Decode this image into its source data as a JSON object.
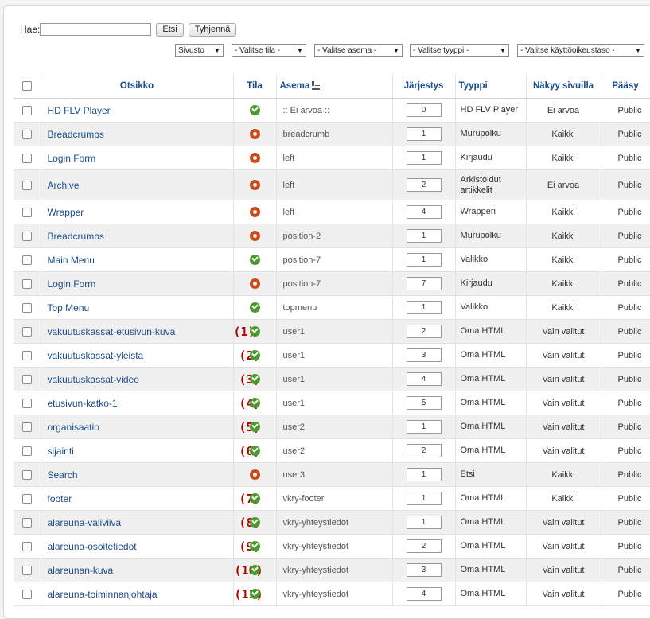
{
  "search": {
    "label": "Hae:",
    "value": "",
    "placeholder": "",
    "search_button": "Etsi",
    "clear_button": "Tyhjennä"
  },
  "filters": {
    "site": "Sivusto",
    "state": "- Valitse tila -",
    "position": "- Valitse asema -",
    "type": "- Valitse tyyppi -",
    "access": "- Valitse käyttöoikeustaso -"
  },
  "headers": {
    "title": "Otsikko",
    "status": "Tila",
    "position": "Asema",
    "order": "Järjestys",
    "type": "Tyyppi",
    "pages": "Näkyy sivuilla",
    "access": "Pääsy"
  },
  "colors": {
    "published": "#4a9a2d",
    "unpublished": "#cc4a17",
    "link": "#1a4c8b",
    "annotation": "#b00000"
  },
  "rows": [
    {
      "title": "HD FLV Player",
      "status": "published",
      "position": ":: Ei arvoa ::",
      "order": "0",
      "type": "HD FLV Player",
      "pages": "Ei arvoa",
      "access": "Public",
      "annotation": ""
    },
    {
      "title": "Breadcrumbs",
      "status": "unpublished",
      "position": "breadcrumb",
      "order": "1",
      "type": "Murupolku",
      "pages": "Kaikki",
      "access": "Public",
      "annotation": ""
    },
    {
      "title": "Login Form",
      "status": "unpublished",
      "position": "left",
      "order": "1",
      "type": "Kirjaudu",
      "pages": "Kaikki",
      "access": "Public",
      "annotation": ""
    },
    {
      "title": "Archive",
      "status": "unpublished",
      "position": "left",
      "order": "2",
      "type": "Arkistoidut artikkelit",
      "pages": "Ei arvoa",
      "access": "Public",
      "annotation": ""
    },
    {
      "title": "Wrapper",
      "status": "unpublished",
      "position": "left",
      "order": "4",
      "type": "Wrapperi",
      "pages": "Kaikki",
      "access": "Public",
      "annotation": ""
    },
    {
      "title": "Breadcrumbs",
      "status": "unpublished",
      "position": "position-2",
      "order": "1",
      "type": "Murupolku",
      "pages": "Kaikki",
      "access": "Public",
      "annotation": ""
    },
    {
      "title": "Main Menu",
      "status": "published",
      "position": "position-7",
      "order": "1",
      "type": "Valikko",
      "pages": "Kaikki",
      "access": "Public",
      "annotation": ""
    },
    {
      "title": "Login Form",
      "status": "unpublished",
      "position": "position-7",
      "order": "7",
      "type": "Kirjaudu",
      "pages": "Kaikki",
      "access": "Public",
      "annotation": ""
    },
    {
      "title": "Top Menu",
      "status": "published",
      "position": "topmenu",
      "order": "1",
      "type": "Valikko",
      "pages": "Kaikki",
      "access": "Public",
      "annotation": ""
    },
    {
      "title": "vakuutuskassat-etusivun-kuva",
      "status": "published",
      "position": "user1",
      "order": "2",
      "type": "Oma HTML",
      "pages": "Vain valitut",
      "access": "Public",
      "annotation": "(1)"
    },
    {
      "title": "vakuutuskassat-yleista",
      "status": "published",
      "position": "user1",
      "order": "3",
      "type": "Oma HTML",
      "pages": "Vain valitut",
      "access": "Public",
      "annotation": "(2)"
    },
    {
      "title": "vakuutuskassat-video",
      "status": "published",
      "position": "user1",
      "order": "4",
      "type": "Oma HTML",
      "pages": "Vain valitut",
      "access": "Public",
      "annotation": "(3)"
    },
    {
      "title": "etusivun-katko-1",
      "status": "published",
      "position": "user1",
      "order": "5",
      "type": "Oma HTML",
      "pages": "Vain valitut",
      "access": "Public",
      "annotation": "(4)"
    },
    {
      "title": "organisaatio",
      "status": "published",
      "position": "user2",
      "order": "1",
      "type": "Oma HTML",
      "pages": "Vain valitut",
      "access": "Public",
      "annotation": "(5)"
    },
    {
      "title": "sijainti",
      "status": "published",
      "position": "user2",
      "order": "2",
      "type": "Oma HTML",
      "pages": "Vain valitut",
      "access": "Public",
      "annotation": "(6)"
    },
    {
      "title": "Search",
      "status": "unpublished",
      "position": "user3",
      "order": "1",
      "type": "Etsi",
      "pages": "Kaikki",
      "access": "Public",
      "annotation": ""
    },
    {
      "title": "footer",
      "status": "published",
      "position": "vkry-footer",
      "order": "1",
      "type": "Oma HTML",
      "pages": "Kaikki",
      "access": "Public",
      "annotation": "(7)"
    },
    {
      "title": "alareuna-valiviiva",
      "status": "published",
      "position": "vkry-yhteystiedot",
      "order": "1",
      "type": "Oma HTML",
      "pages": "Vain valitut",
      "access": "Public",
      "annotation": "(8)"
    },
    {
      "title": "alareuna-osoitetiedot",
      "status": "published",
      "position": "vkry-yhteystiedot",
      "order": "2",
      "type": "Oma HTML",
      "pages": "Vain valitut",
      "access": "Public",
      "annotation": "(9)"
    },
    {
      "title": "alareunan-kuva",
      "status": "published",
      "position": "vkry-yhteystiedot",
      "order": "3",
      "type": "Oma HTML",
      "pages": "Vain valitut",
      "access": "Public",
      "annotation": "(10)"
    },
    {
      "title": "alareuna-toiminnanjohtaja",
      "status": "published",
      "position": "vkry-yhteystiedot",
      "order": "4",
      "type": "Oma HTML",
      "pages": "Vain valitut",
      "access": "Public",
      "annotation": "(11)"
    }
  ]
}
